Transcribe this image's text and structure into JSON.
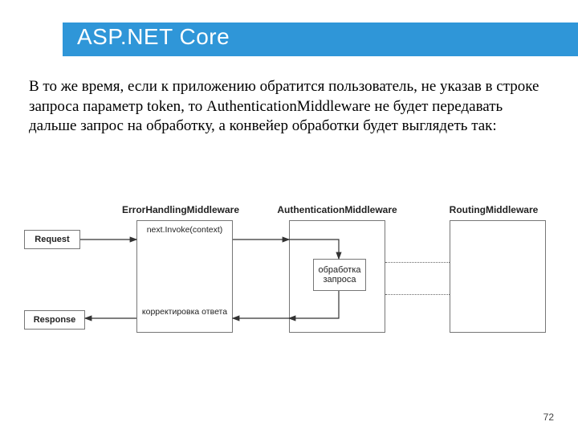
{
  "slide": {
    "title": "ASP.NET Core",
    "body": "В то же время, если к приложению обратится пользователь, не указав в строке запроса параметр token, то AuthenticationMiddleware не будет передавать дальше запрос на обработку, а конвейер обработки будет выглядеть так:",
    "bullet_marker": "",
    "page_number": "72"
  },
  "diagram": {
    "request_label": "Request",
    "response_label": "Response",
    "middlewares": {
      "error": {
        "title": "ErrorHandlingMiddleware",
        "top_caption": "next.Invoke(context)",
        "bottom_caption": "корректировка ответа"
      },
      "auth": {
        "title": "AuthenticationMiddleware",
        "center_box": "обработка запроса"
      },
      "routing": {
        "title": "RoutingMiddleware"
      }
    }
  }
}
